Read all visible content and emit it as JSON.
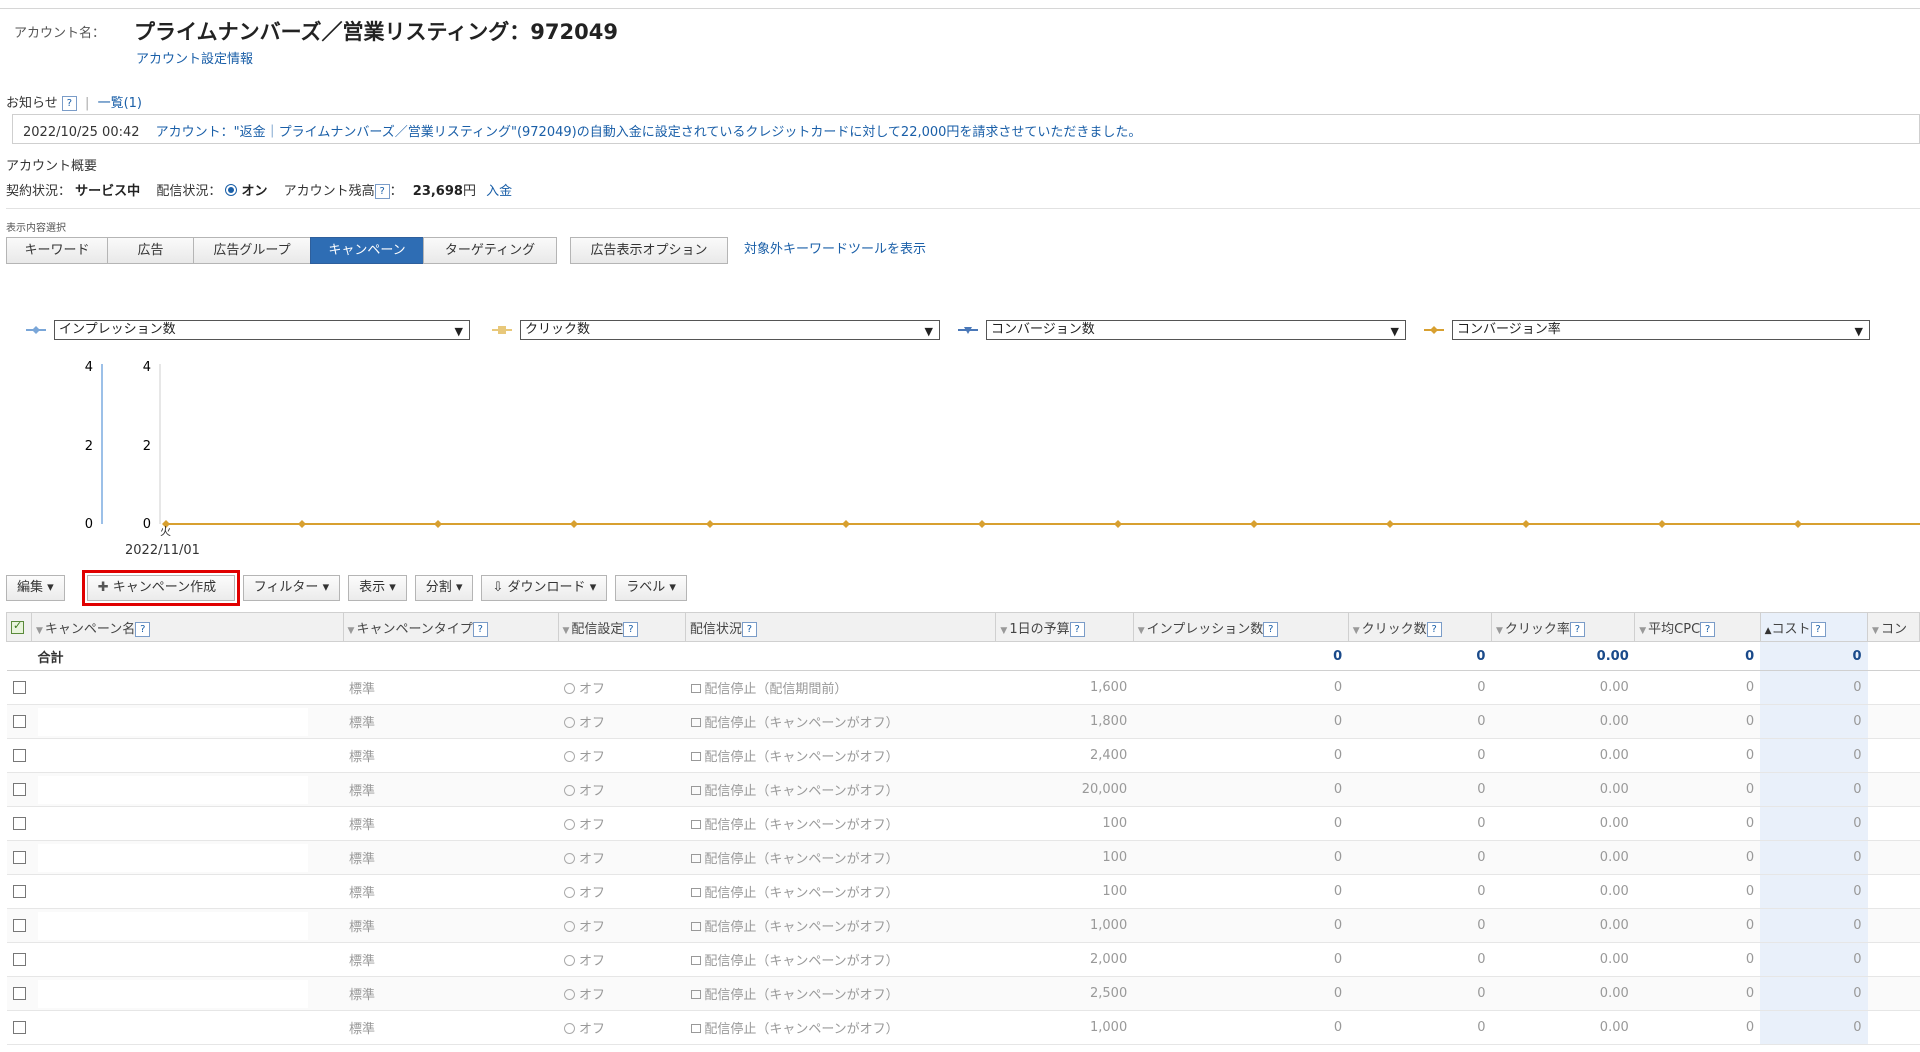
{
  "account": {
    "label": "アカウント名：",
    "name": "プライムナンバーズ／営業リスティング：972049",
    "settings_link": "アカウント設定情報"
  },
  "notice": {
    "label": "お知らせ",
    "help": "?",
    "list_link": "一覧(1)",
    "date": "2022/10/25 00:42",
    "message": "アカウント：\"返金｜プライムナンバーズ／営業リスティング\"(972049)の自動入金に設定されているクレジットカードに対して22,000円を請求させていただきました。"
  },
  "summary": {
    "title": "アカウント概要",
    "contract_label": "契約状況：",
    "contract_value": "サービス中",
    "delivery_label": "配信状況：",
    "delivery_value": "オン",
    "balance_label": "アカウント残高",
    "balance_value": "23,698",
    "balance_unit": "円",
    "deposit_link": "入金"
  },
  "tabs_label": "表示内容選択",
  "tabs": [
    "キーワード",
    "広告",
    "広告グループ",
    "キャンペーン",
    "ターゲティング",
    "広告表示オプション"
  ],
  "active_tab": "キャンペーン",
  "keyword_tool_link": "対象外キーワードツールを表示",
  "metrics": [
    {
      "label": "インプレッション数",
      "color": "#7aa6d8",
      "marker": "diamond"
    },
    {
      "label": "クリック数",
      "color": "#e8c87a",
      "marker": "square"
    },
    {
      "label": "コンバージョン数",
      "color": "#4a78b8",
      "marker": "triangle"
    },
    {
      "label": "コンバージョン率",
      "color": "#d8a030",
      "marker": "diamond"
    }
  ],
  "chart": {
    "left_axis_ticks": [
      "4",
      "2",
      "0"
    ],
    "right_axis_ticks": [
      "4",
      "2",
      "0"
    ],
    "x_first_day": "火",
    "x_first_date": "2022/11/01"
  },
  "chart_data": {
    "type": "line",
    "x_first_label": "2022/11/01",
    "series": [
      {
        "name": "コンバージョン率",
        "values": [
          0,
          0,
          0,
          0,
          0,
          0,
          0,
          0,
          0,
          0,
          0,
          0,
          0,
          0
        ]
      }
    ],
    "ylim": [
      0,
      4
    ]
  },
  "toolbar": {
    "edit": "編集",
    "create": "キャンペーン作成",
    "filter": "フィルター",
    "display": "表示",
    "split": "分割",
    "download": "ダウンロード",
    "label": "ラベル"
  },
  "table": {
    "headers": [
      "キャンペーン名",
      "キャンペーンタイプ",
      "配信設定",
      "配信状況",
      "1日の予算",
      "インプレッション数",
      "クリック数",
      "クリック率",
      "平均CPC",
      "コスト",
      "コン"
    ],
    "total": {
      "label": "合計",
      "impressions": "0",
      "clicks": "0",
      "ctr": "0.00",
      "cpc": "0",
      "cost": "0"
    },
    "rows": [
      {
        "type": "標準",
        "setting": "オフ",
        "status": "配信停止（配信期間前）",
        "budget": "1,600",
        "imp": "0",
        "clicks": "0",
        "ctr": "0.00",
        "cpc": "0",
        "cost": "0"
      },
      {
        "type": "標準",
        "setting": "オフ",
        "status": "配信停止（キャンペーンがオフ）",
        "budget": "1,800",
        "imp": "0",
        "clicks": "0",
        "ctr": "0.00",
        "cpc": "0",
        "cost": "0"
      },
      {
        "type": "標準",
        "setting": "オフ",
        "status": "配信停止（キャンペーンがオフ）",
        "budget": "2,400",
        "imp": "0",
        "clicks": "0",
        "ctr": "0.00",
        "cpc": "0",
        "cost": "0"
      },
      {
        "type": "標準",
        "setting": "オフ",
        "status": "配信停止（キャンペーンがオフ）",
        "budget": "20,000",
        "imp": "0",
        "clicks": "0",
        "ctr": "0.00",
        "cpc": "0",
        "cost": "0"
      },
      {
        "type": "標準",
        "setting": "オフ",
        "status": "配信停止（キャンペーンがオフ）",
        "budget": "100",
        "imp": "0",
        "clicks": "0",
        "ctr": "0.00",
        "cpc": "0",
        "cost": "0"
      },
      {
        "type": "標準",
        "setting": "オフ",
        "status": "配信停止（キャンペーンがオフ）",
        "budget": "100",
        "imp": "0",
        "clicks": "0",
        "ctr": "0.00",
        "cpc": "0",
        "cost": "0"
      },
      {
        "type": "標準",
        "setting": "オフ",
        "status": "配信停止（キャンペーンがオフ）",
        "budget": "100",
        "imp": "0",
        "clicks": "0",
        "ctr": "0.00",
        "cpc": "0",
        "cost": "0"
      },
      {
        "type": "標準",
        "setting": "オフ",
        "status": "配信停止（キャンペーンがオフ）",
        "budget": "1,000",
        "imp": "0",
        "clicks": "0",
        "ctr": "0.00",
        "cpc": "0",
        "cost": "0"
      },
      {
        "type": "標準",
        "setting": "オフ",
        "status": "配信停止（キャンペーンがオフ）",
        "budget": "2,000",
        "imp": "0",
        "clicks": "0",
        "ctr": "0.00",
        "cpc": "0",
        "cost": "0"
      },
      {
        "type": "標準",
        "setting": "オフ",
        "status": "配信停止（キャンペーンがオフ）",
        "budget": "2,500",
        "imp": "0",
        "clicks": "0",
        "ctr": "0.00",
        "cpc": "0",
        "cost": "0"
      },
      {
        "type": "標準",
        "setting": "オフ",
        "status": "配信停止（キャンペーンがオフ）",
        "budget": "1,000",
        "imp": "0",
        "clicks": "0",
        "ctr": "0.00",
        "cpc": "0",
        "cost": "0"
      }
    ]
  }
}
